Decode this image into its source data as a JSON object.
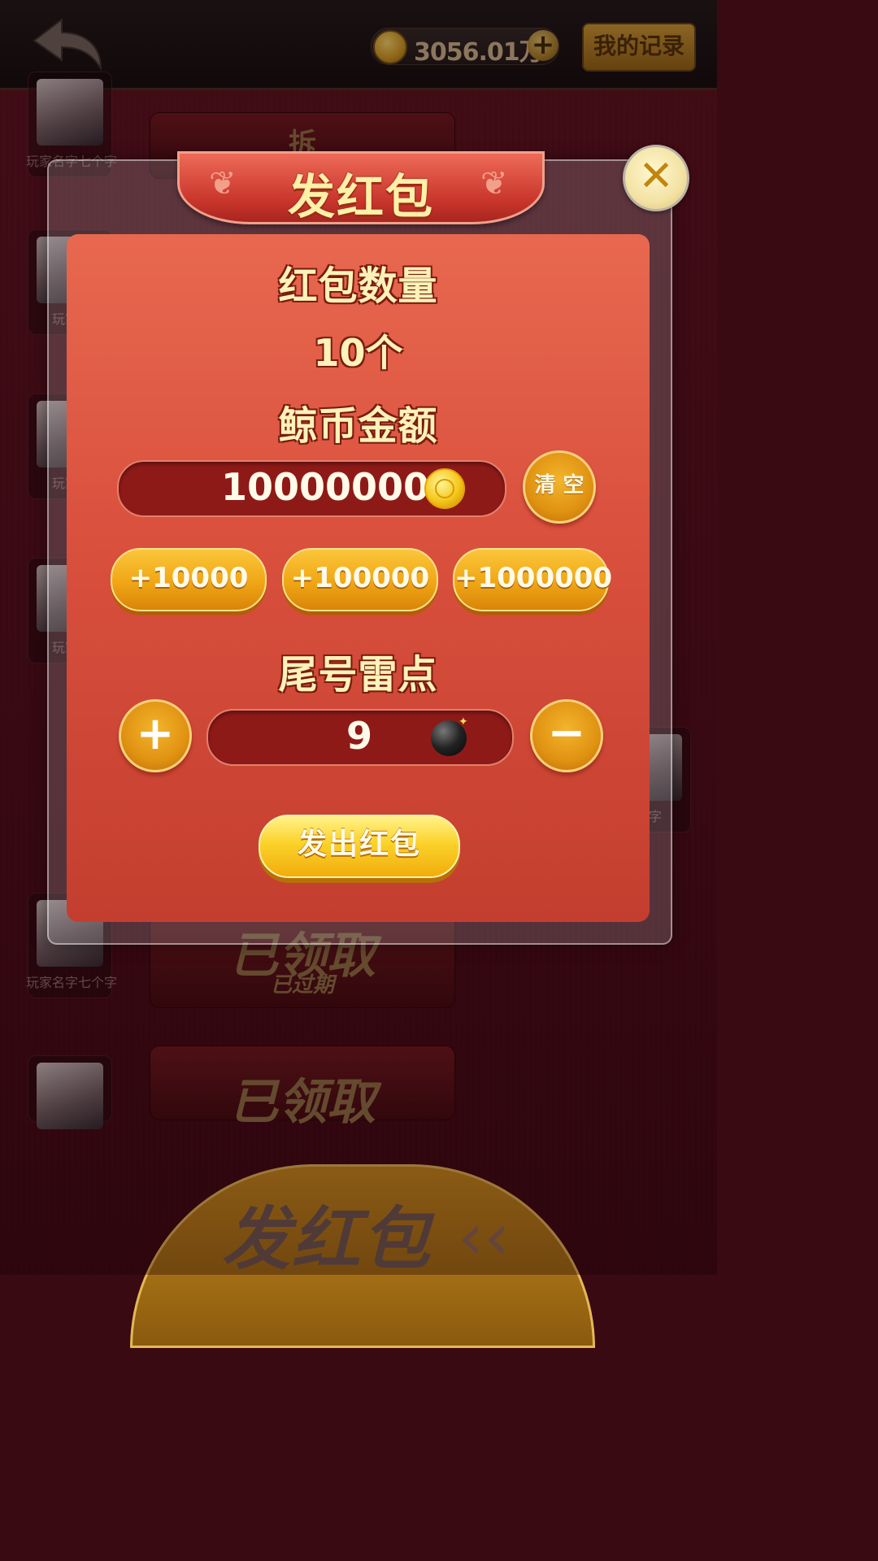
{
  "header": {
    "balance": "3056.01万",
    "record_label": "我的记录"
  },
  "background": {
    "player_name": "玩家名字七个字",
    "player_name_partial_left": "玩家名",
    "player_name_partial_right": "字七个字",
    "rp_top_icon_text": "拆",
    "rp_claimed": "已领取",
    "rp_expired": "已过期",
    "bottom_button": "发红包"
  },
  "modal": {
    "title": "发红包",
    "count_label": "红包数量",
    "count_value": "10个",
    "amount_label": "鲸币金额",
    "amount_value": "10000000",
    "clear_label": "清 空",
    "quick_add": [
      "+10000",
      "+100000",
      "+1000000"
    ],
    "mine_label": "尾号雷点",
    "mine_value": "9",
    "plus_symbol": "+",
    "minus_symbol": "−",
    "send_label": "发出红包",
    "close_symbol": "✕"
  }
}
